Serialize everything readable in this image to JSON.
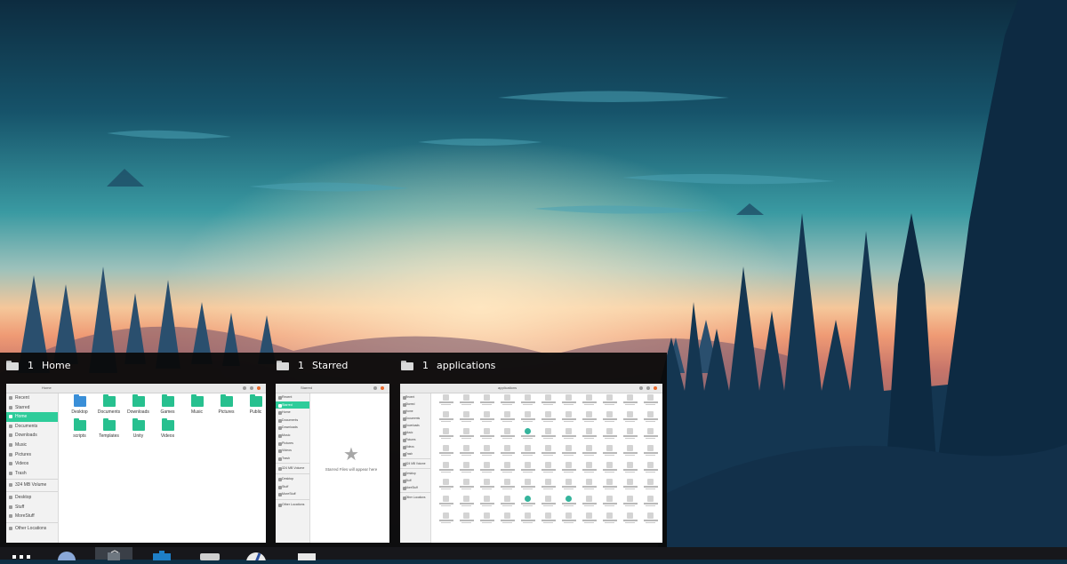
{
  "switcher": {
    "windows": [
      {
        "workspace": "1",
        "title": "Home",
        "path": "Home",
        "sidebar": [
          "Recent",
          "Starred",
          "Home",
          "Documents",
          "Downloads",
          "Music",
          "Pictures",
          "Videos",
          "Trash",
          "324 MB Volume",
          "Desktop",
          "Stuff",
          "MoreStuff",
          "Other Locations"
        ],
        "active_sidebar": "Home",
        "folders": [
          "Desktop",
          "Documents",
          "Downloads",
          "Games",
          "Music",
          "Pictures",
          "Public",
          "scripts",
          "Templates",
          "Unity",
          "Videos"
        ]
      },
      {
        "workspace": "1",
        "title": "Starred",
        "path": "Starred",
        "active_sidebar": "Starred",
        "empty_message": "Starred Files will appear here"
      },
      {
        "workspace": "1",
        "title": "applications",
        "path": "applications"
      }
    ]
  },
  "taskbar": {
    "icons": [
      "app-grid-icon",
      "browser-icon",
      "files-icon",
      "store-icon",
      "text-editor-icon",
      "clock-icon",
      "notes-icon"
    ]
  },
  "colors": {
    "accent": "#2ecc9a",
    "folder": "#27c08f",
    "close": "#e8692c"
  }
}
